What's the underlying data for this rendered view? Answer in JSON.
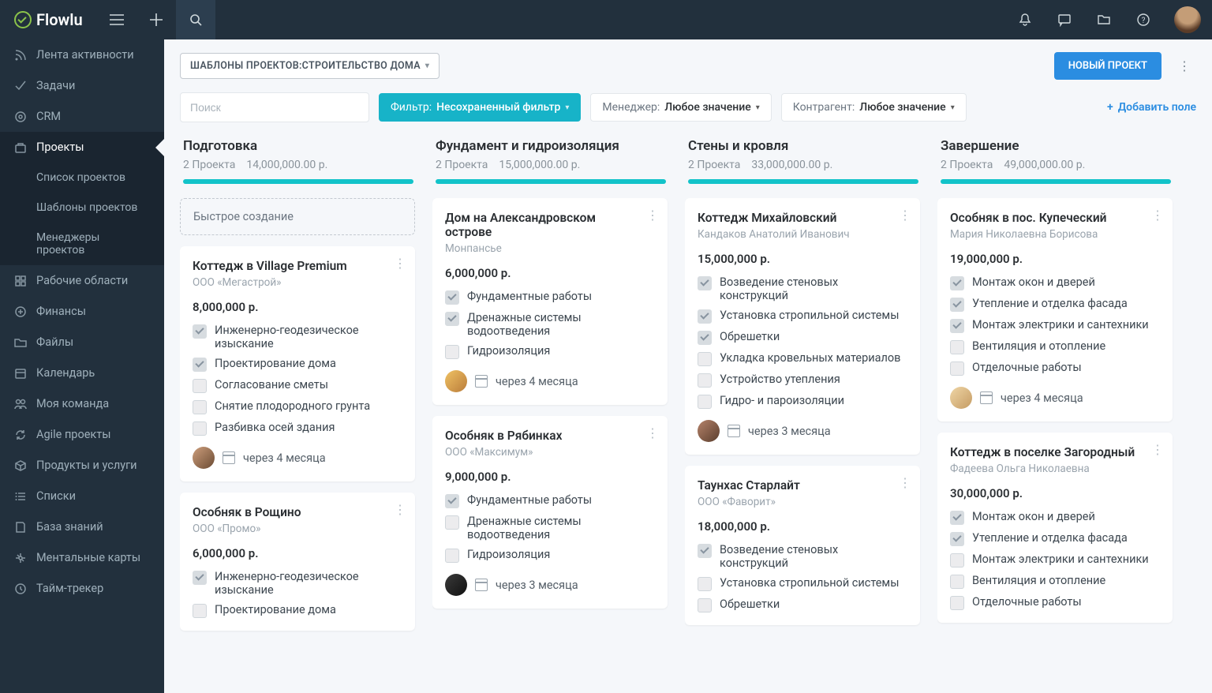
{
  "brand": "Flowlu",
  "sidebar": {
    "items": [
      {
        "label": "Лента активности"
      },
      {
        "label": "Задачи"
      },
      {
        "label": "CRM"
      },
      {
        "label": "Проекты"
      },
      {
        "label": "Рабочие области"
      },
      {
        "label": "Финансы"
      },
      {
        "label": "Файлы"
      },
      {
        "label": "Календарь"
      },
      {
        "label": "Моя команда"
      },
      {
        "label": "Agile проекты"
      },
      {
        "label": "Продукты и услуги"
      },
      {
        "label": "Списки"
      },
      {
        "label": "База знаний"
      },
      {
        "label": "Ментальные карты"
      },
      {
        "label": "Тайм-трекер"
      }
    ],
    "subitems": [
      {
        "label": "Список проектов"
      },
      {
        "label": "Шаблоны проектов"
      },
      {
        "label": "Менеджеры проектов"
      }
    ]
  },
  "toolbar": {
    "chip": "ШАБЛОНЫ ПРОЕКТОВ:СТРОИТЕЛЬСТВО ДОМА",
    "new_project": "НОВЫЙ ПРОЕКТ"
  },
  "filters": {
    "search_placeholder": "Поиск",
    "filter_label": "Фильтр:",
    "filter_value": "Несохраненный фильтр",
    "manager_label": "Менеджер:",
    "manager_value": "Любое значение",
    "contragent_label": "Контрагент:",
    "contragent_value": "Любое значение",
    "add_field": "Добавить поле"
  },
  "columns": [
    {
      "title": "Подготовка",
      "count": "2 Проекта",
      "sum": "14,000,000.00 р.",
      "quick": "Быстрое создание",
      "cards": [
        {
          "title": "Коттедж в Village Premium",
          "subtitle": "ООО «Мегастрой»",
          "price": "8,000,000 р.",
          "due": "через 4 месяца",
          "avatar": "a",
          "tasks": [
            {
              "done": true,
              "text": "Инженерно-геодезическое изыскание"
            },
            {
              "done": true,
              "text": "Проектирование дома"
            },
            {
              "done": false,
              "text": "Согласование сметы"
            },
            {
              "done": false,
              "text": "Снятие плодородного грунта"
            },
            {
              "done": false,
              "text": "Разбивка осей здания"
            }
          ]
        },
        {
          "title": "Особняк в Рощино",
          "subtitle": "ООО «Промо»",
          "price": "6,000,000 р.",
          "tasks": [
            {
              "done": true,
              "text": "Инженерно-геодезическое изыскание"
            },
            {
              "done": false,
              "text": "Проектирование дома"
            }
          ]
        }
      ]
    },
    {
      "title": "Фундамент и гидроизоляция",
      "count": "2 Проекта",
      "sum": "15,000,000.00 р.",
      "cards": [
        {
          "title": "Дом на Александровском острове",
          "subtitle": "Монпансье",
          "price": "6,000,000 р.",
          "due": "через 4 месяца",
          "avatar": "b",
          "tasks": [
            {
              "done": true,
              "text": "Фундаментные работы"
            },
            {
              "done": true,
              "text": "Дренажные системы водоотведения"
            },
            {
              "done": false,
              "text": "Гидроизоляция"
            }
          ]
        },
        {
          "title": "Особняк в Рябинках",
          "subtitle": "ООО «Максимум»",
          "price": "9,000,000 р.",
          "due": "через 3 месяца",
          "avatar": "c",
          "tasks": [
            {
              "done": true,
              "text": "Фундаментные работы"
            },
            {
              "done": false,
              "text": "Дренажные системы водоотведения"
            },
            {
              "done": false,
              "text": "Гидроизоляция"
            }
          ]
        }
      ]
    },
    {
      "title": "Стены и кровля",
      "count": "2 Проекта",
      "sum": "33,000,000.00 р.",
      "cards": [
        {
          "title": "Коттедж Михайловский",
          "subtitle": "Кандаков Анатолий Иванович",
          "price": "15,000,000 р.",
          "due": "через 3 месяца",
          "avatar": "d",
          "tasks": [
            {
              "done": true,
              "text": "Возведение стеновых конструкций"
            },
            {
              "done": true,
              "text": "Установка стропильной системы"
            },
            {
              "done": true,
              "text": "Обрешетки"
            },
            {
              "done": false,
              "text": "Укладка кровельных материалов"
            },
            {
              "done": false,
              "text": "Устройство утепления"
            },
            {
              "done": false,
              "text": "Гидро- и пароизоляции"
            }
          ]
        },
        {
          "title": "Таунхас Старлайт",
          "subtitle": "ООО «Фаворит»",
          "price": "18,000,000 р.",
          "tasks": [
            {
              "done": true,
              "text": "Возведение стеновых конструкций"
            },
            {
              "done": false,
              "text": "Установка стропильной системы"
            },
            {
              "done": false,
              "text": "Обрешетки"
            }
          ]
        }
      ]
    },
    {
      "title": "Завершение",
      "count": "2 Проекта",
      "sum": "49,000,000.00 р.",
      "cards": [
        {
          "title": "Особняк в пос. Купеческий",
          "subtitle": "Мария Николаевна Борисова",
          "price": "19,000,000 р.",
          "due": "через 4 месяца",
          "avatar": "e",
          "tasks": [
            {
              "done": true,
              "text": "Монтаж окон и дверей"
            },
            {
              "done": true,
              "text": "Утепление и отделка фасада"
            },
            {
              "done": true,
              "text": "Монтаж электрики и сантехники"
            },
            {
              "done": false,
              "text": "Вентиляция и отопление"
            },
            {
              "done": false,
              "text": "Отделочные работы"
            }
          ]
        },
        {
          "title": "Коттедж в поселке Загородный",
          "subtitle": "Фадеева Ольга Николаевна",
          "price": "30,000,000 р.",
          "tasks": [
            {
              "done": true,
              "text": "Монтаж окон и дверей"
            },
            {
              "done": true,
              "text": "Утепление и отделка фасада"
            },
            {
              "done": false,
              "text": "Монтаж электрики и сантехники"
            },
            {
              "done": false,
              "text": "Вентиляция и отопление"
            },
            {
              "done": false,
              "text": "Отделочные работы"
            }
          ]
        }
      ]
    }
  ]
}
